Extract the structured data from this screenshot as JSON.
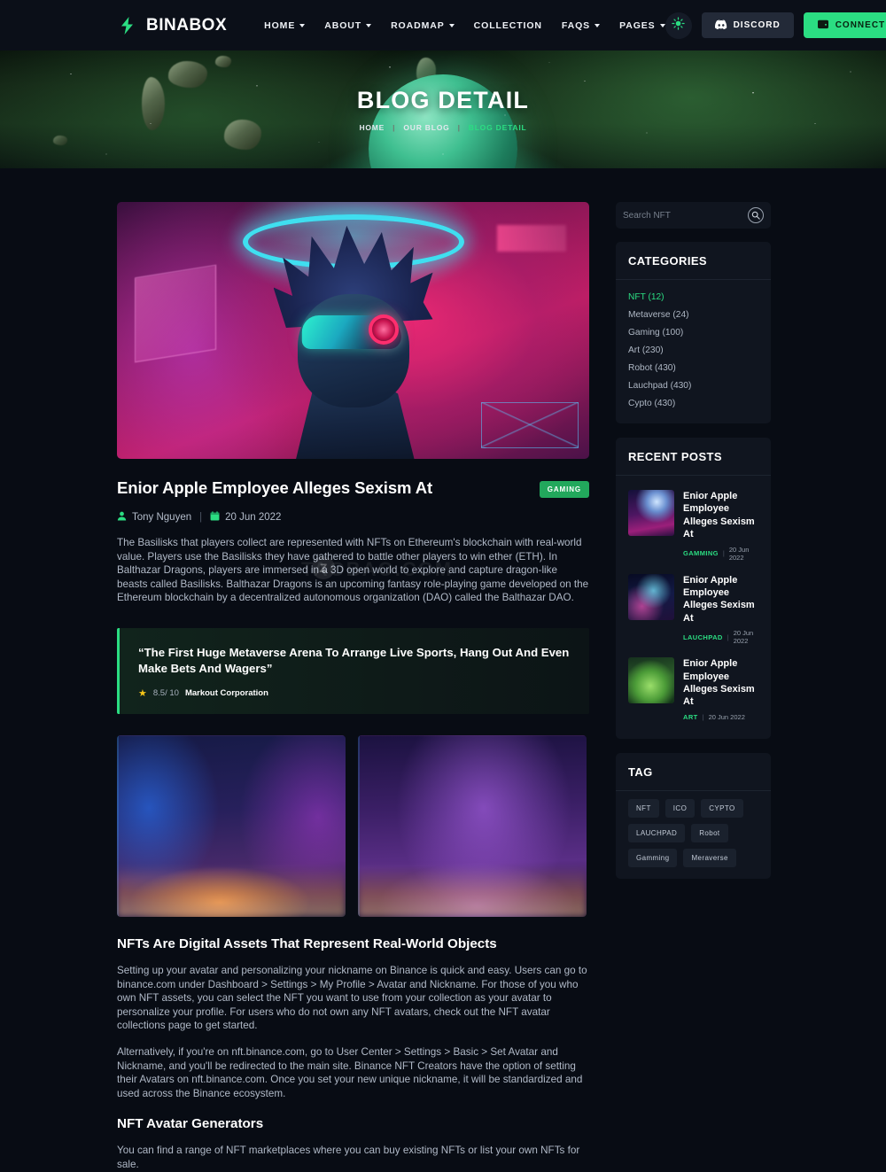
{
  "header": {
    "brand": "BINABOX",
    "brand_icon": "binabox-logo-icon",
    "nav": [
      {
        "label": "HOME",
        "has_caret": true
      },
      {
        "label": "ABOUT",
        "has_caret": true
      },
      {
        "label": "ROADMAP",
        "has_caret": true
      },
      {
        "label": "COLLECTION",
        "has_caret": false
      },
      {
        "label": "FAQS",
        "has_caret": true
      },
      {
        "label": "PAGES",
        "has_caret": true
      }
    ],
    "theme_toggle_icon": "sun-icon",
    "discord_label": "DISCORD",
    "connect_label": "CONNECT",
    "accent": "#2bdd82"
  },
  "hero": {
    "title": "BLOG DETAIL",
    "breadcrumbs": [
      {
        "label": "HOME",
        "active": false
      },
      {
        "label": "OUR BLOG",
        "active": false
      },
      {
        "label": "BLOG DETAIL",
        "active": true
      }
    ]
  },
  "post": {
    "featured_image_alt": "cyberpunk character with neon halo",
    "title": "Enior Apple Employee Alleges Sexism At",
    "badge": "GAMING",
    "author": "Tony Nguyen",
    "date": "20 Jun 2022",
    "body": "The Basilisks that players collect are represented with NFTs on Ethereum's blockchain with real-world value. Players use the Basilisks they have gathered to battle other players to win ether (ETH). In Balthazar Dragons, players are immersed in a 3D open world to explore and capture dragon-like beasts called Basilisks.  Balthazar Dragons is an upcoming fantasy role-playing game developed on the Ethereum blockchain by a decentralized autonomous organization (DAO) called the Balthazar DAO.",
    "quote": {
      "text": "“The First Huge Metaverse Arena To Arrange Live Sports, Hang Out And Even Make Bets And Wagers”",
      "score": "8.5/ 10",
      "company": "Markout Corporation"
    },
    "gallery": [
      {
        "alt": "neon city street with car and drones"
      },
      {
        "alt": "purple neon city with motorcycle"
      }
    ],
    "section_1_heading": "NFTs Are Digital Assets That Represent Real-World Objects",
    "section_1_p1": "Setting up your avatar and personalizing your nickname on Binance is quick and easy. Users can go to binance.com under Dashboard > Settings > My Profile > Avatar and Nickname. For those of you who own NFT assets, you can select the NFT you want to use from your collection as your avatar to personalize your profile. For users who do not own any NFT avatars, check out the NFT avatar collections page to get started.",
    "section_1_p2": "Alternatively, if you're on nft.binance.com, go to User Center > Settings > Basic > Set Avatar and Nickname, and you'll be redirected to the main site. Binance NFT Creators have the option of setting their Avatars on nft.binance.com. Once you set your new unique nickname, it will be standardized and used across the Binance ecosystem.",
    "section_2_heading": "NFT Avatar Generators",
    "section_2_p1": "You can find a range of NFT marketplaces where you can buy existing NFTs or list your own NFTs for sale."
  },
  "sidebar": {
    "search": {
      "placeholder": "Search NFT",
      "value": "",
      "icon": "search-icon"
    },
    "categories": {
      "heading": "CATEGORIES",
      "items": [
        {
          "label": "NFT (12)",
          "active": true
        },
        {
          "label": "Metaverse (24)",
          "active": false
        },
        {
          "label": "Gaming (100)",
          "active": false
        },
        {
          "label": "Art (230)",
          "active": false
        },
        {
          "label": "Robot (430)",
          "active": false
        },
        {
          "label": "Lauchpad (430)",
          "active": false
        },
        {
          "label": "Cypto (430)",
          "active": false
        }
      ]
    },
    "recent_posts": {
      "heading": "RECENT POSTS",
      "items": [
        {
          "title": "Enior Apple Employee Alleges Sexism At",
          "category": "GAMMING",
          "date": "20 Jun 2022",
          "thumb_alt": "purple space city"
        },
        {
          "title": "Enior Apple Employee Alleges Sexism At",
          "category": "LAUCHPAD",
          "date": "20 Jun 2022",
          "thumb_alt": "neon jellyfish"
        },
        {
          "title": "Enior Apple Employee Alleges Sexism At",
          "category": "ART",
          "date": "20 Jun 2022",
          "thumb_alt": "green creature"
        }
      ]
    },
    "tag": {
      "heading": "TAG",
      "items": [
        "NFT",
        "ICO",
        "CYPTO",
        "LAUCHPAD",
        "Robot",
        "Gamming",
        "Meraverse"
      ]
    }
  },
  "watermark": {
    "text": "TAOBAO.COM",
    "badge": "Z"
  }
}
